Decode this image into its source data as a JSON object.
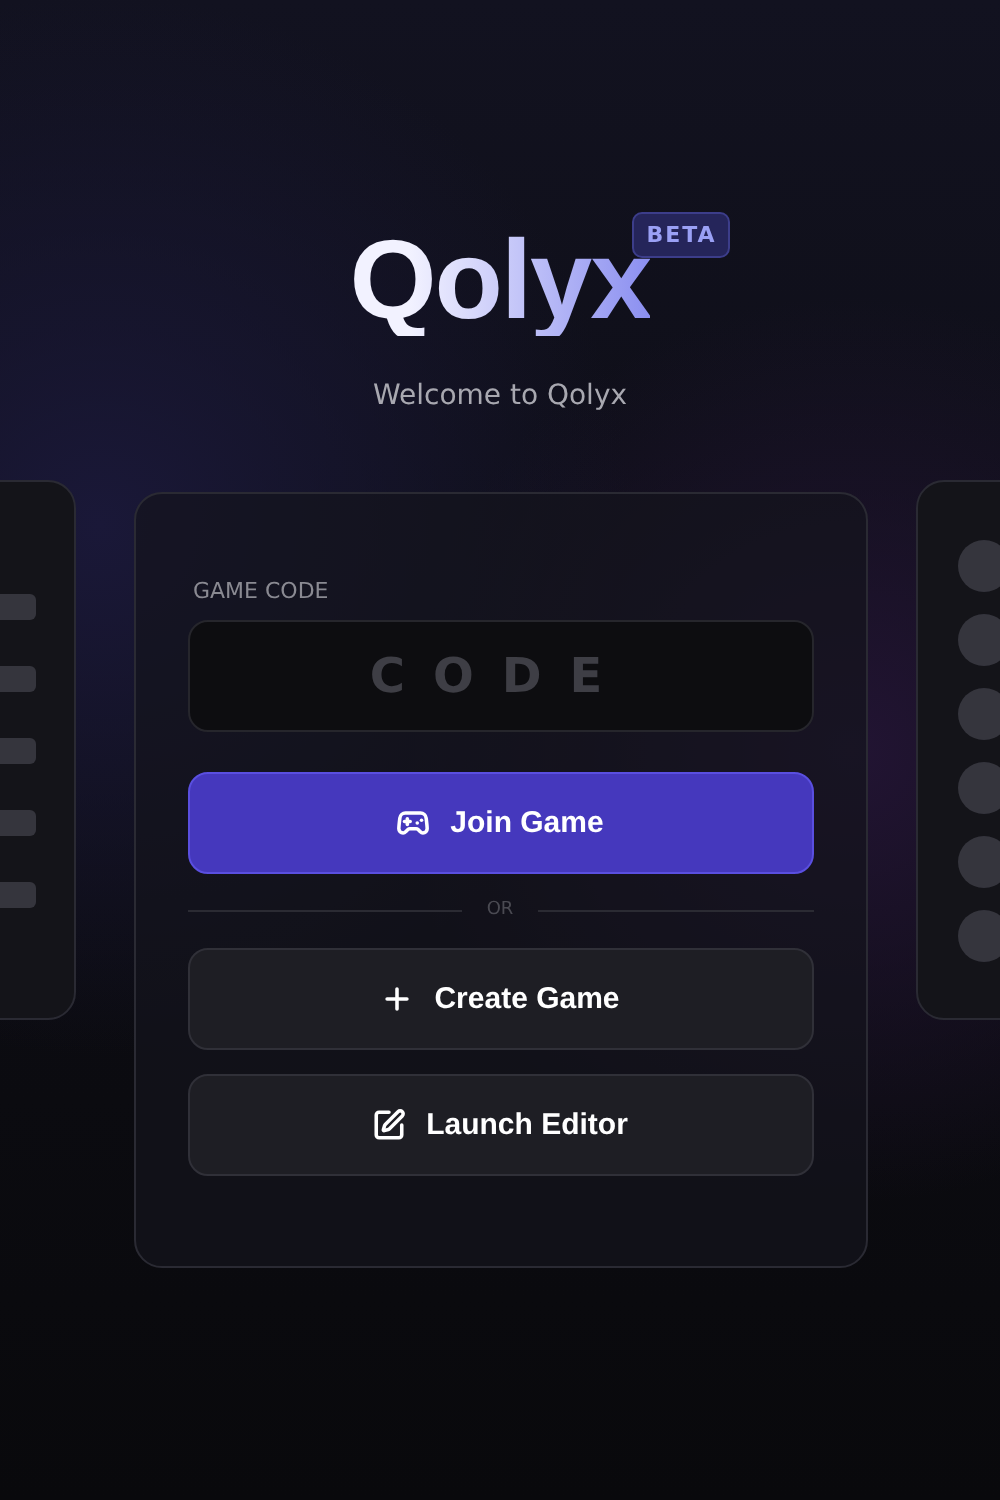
{
  "logo": {
    "name": "Qolyx",
    "badge": "BETA"
  },
  "subtitle": "Welcome to Qolyx",
  "form": {
    "label": "GAME CODE",
    "placeholder": "CODE"
  },
  "divider": "OR",
  "buttons": [
    {
      "label": "Join Game",
      "kind": "join"
    },
    {
      "label": "Create Game",
      "kind": "create"
    },
    {
      "label": "Launch Editor",
      "kind": "editor"
    }
  ]
}
